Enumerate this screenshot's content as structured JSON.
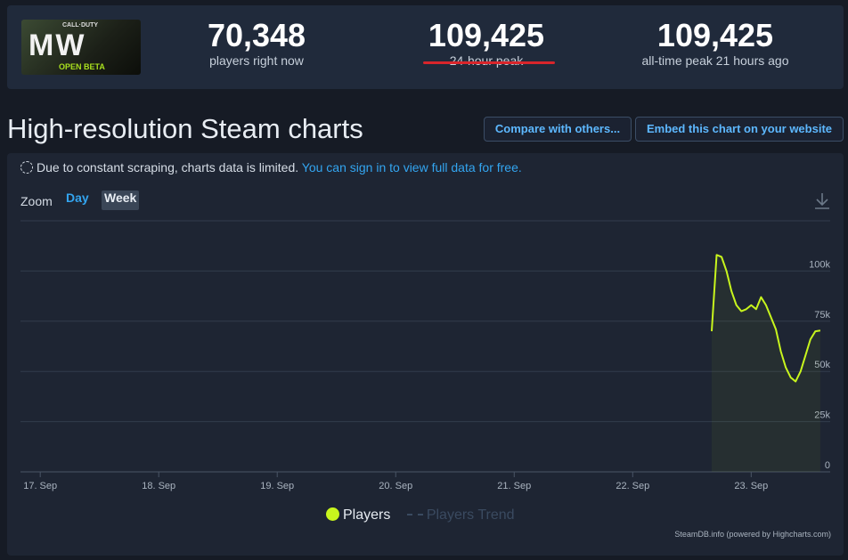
{
  "stats": {
    "game_image_alt": "Call of Duty MWII Open Beta",
    "game_logo_top": "CALL·DUTY",
    "game_logo_main": "MW",
    "game_logo_bottom": "OPEN BETA",
    "items": [
      {
        "value": "70,348",
        "label": "players right now"
      },
      {
        "value": "109,425",
        "label": "24-hour peak"
      },
      {
        "value": "109,425",
        "label": "all-time peak 21 hours ago"
      }
    ]
  },
  "header": {
    "title": "High-resolution Steam charts",
    "compare_label": "Compare with others...",
    "embed_label": "Embed this chart on your website"
  },
  "notice": {
    "text": "Due to constant scraping, charts data is limited.",
    "link": "You can sign in to view full data for free."
  },
  "zoom": {
    "label": "Zoom",
    "day": "Day",
    "week": "Week",
    "selected": "Week"
  },
  "colors": {
    "players": "#c8f51d",
    "trend": "#3a4a60",
    "accent": "#33a5f0",
    "highlight": "#d8252b"
  },
  "chart_data": {
    "type": "line",
    "xlabel": "",
    "ylabel": "",
    "x_ticks": [
      "17. Sep",
      "18. Sep",
      "19. Sep",
      "20. Sep",
      "21. Sep",
      "22. Sep",
      "23. Sep"
    ],
    "y_ticks": [
      "0",
      "25k",
      "50k",
      "75k",
      "100k"
    ],
    "ylim": [
      0,
      125000
    ],
    "x_range": [
      "2022-09-16T20:00",
      "2022-09-23T16:00"
    ],
    "grid": true,
    "legend_position": "bottom-center",
    "series": [
      {
        "name": "Players",
        "values": [
          [
            "2022-09-22T16:00",
            70000
          ],
          [
            "2022-09-22T17:00",
            108000
          ],
          [
            "2022-09-22T18:00",
            107000
          ],
          [
            "2022-09-22T19:00",
            100000
          ],
          [
            "2022-09-22T20:00",
            90000
          ],
          [
            "2022-09-22T21:00",
            83000
          ],
          [
            "2022-09-22T22:00",
            80000
          ],
          [
            "2022-09-22T23:00",
            81000
          ],
          [
            "2022-09-23T00:00",
            83000
          ],
          [
            "2022-09-23T01:00",
            81000
          ],
          [
            "2022-09-23T02:00",
            87000
          ],
          [
            "2022-09-23T03:00",
            83000
          ],
          [
            "2022-09-23T04:00",
            77000
          ],
          [
            "2022-09-23T05:00",
            71000
          ],
          [
            "2022-09-23T06:00",
            60000
          ],
          [
            "2022-09-23T07:00",
            52000
          ],
          [
            "2022-09-23T08:00",
            47000
          ],
          [
            "2022-09-23T09:00",
            45000
          ],
          [
            "2022-09-23T10:00",
            50000
          ],
          [
            "2022-09-23T11:00",
            58000
          ],
          [
            "2022-09-23T12:00",
            66000
          ],
          [
            "2022-09-23T13:00",
            70000
          ],
          [
            "2022-09-23T14:00",
            70348
          ]
        ]
      },
      {
        "name": "Players Trend",
        "values": []
      }
    ]
  },
  "credit": "SteamDB.info (powered by Highcharts.com)"
}
